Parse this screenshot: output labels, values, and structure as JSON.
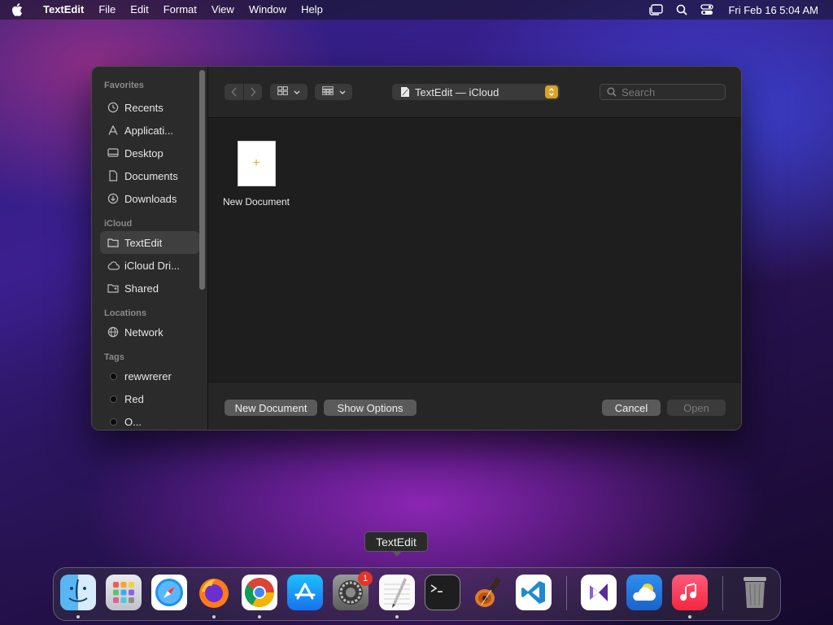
{
  "menubar": {
    "app_name": "TextEdit",
    "menus": [
      "File",
      "Edit",
      "Format",
      "View",
      "Window",
      "Help"
    ],
    "clock": "Fri Feb 16  5:04 AM"
  },
  "dialog": {
    "location": "TextEdit — iCloud",
    "search_placeholder": "Search",
    "sidebar": {
      "favorites_title": "Favorites",
      "favorites": [
        {
          "label": "Recents",
          "icon": "clock-icon"
        },
        {
          "label": "Applicati...",
          "icon": "applications-icon"
        },
        {
          "label": "Desktop",
          "icon": "desktop-icon"
        },
        {
          "label": "Documents",
          "icon": "document-icon"
        },
        {
          "label": "Downloads",
          "icon": "download-icon"
        }
      ],
      "icloud_title": "iCloud",
      "icloud": [
        {
          "label": "TextEdit",
          "icon": "folder-icon",
          "selected": true
        },
        {
          "label": "iCloud Dri...",
          "icon": "cloud-icon"
        },
        {
          "label": "Shared",
          "icon": "shared-folder-icon"
        }
      ],
      "locations_title": "Locations",
      "locations": [
        {
          "label": "Network",
          "icon": "globe-icon"
        }
      ],
      "tags_title": "Tags",
      "tags": [
        {
          "label": "rewwrerer"
        },
        {
          "label": "Red"
        },
        {
          "label": "O..."
        }
      ]
    },
    "files": [
      {
        "label": "New Document",
        "icon": "new-document-icon"
      }
    ],
    "buttons": {
      "new_document": "New Document",
      "show_options": "Show Options",
      "cancel": "Cancel",
      "open": "Open"
    }
  },
  "tooltip": "TextEdit",
  "dock": {
    "items": [
      {
        "name": "Finder",
        "icon": "finder-icon",
        "running": true
      },
      {
        "name": "Launchpad",
        "icon": "launchpad-icon",
        "running": false
      },
      {
        "name": "Safari",
        "icon": "safari-icon",
        "running": false
      },
      {
        "name": "Firefox",
        "icon": "firefox-icon",
        "running": true
      },
      {
        "name": "Chrome",
        "icon": "chrome-icon",
        "running": true
      },
      {
        "name": "App Store",
        "icon": "app-store-icon",
        "running": false
      },
      {
        "name": "System Preferences",
        "icon": "system-preferences-icon",
        "running": false,
        "badge": "1"
      },
      {
        "name": "TextEdit",
        "icon": "textedit-icon",
        "running": true
      },
      {
        "name": "Terminal",
        "icon": "terminal-icon",
        "running": false
      },
      {
        "name": "GarageBand",
        "icon": "garageband-icon",
        "running": false
      },
      {
        "name": "Visual Studio Code",
        "icon": "vscode-icon",
        "running": false
      },
      {
        "name": "Visual Studio",
        "icon": "visual-studio-icon",
        "running": false
      },
      {
        "name": "Weather",
        "icon": "weather-icon",
        "running": false
      },
      {
        "name": "Music",
        "icon": "music-icon",
        "running": true
      },
      {
        "name": "Trash",
        "icon": "trash-icon",
        "running": false
      }
    ],
    "badge": "1"
  },
  "colors": {
    "accent_stepper": "#d9a32a",
    "badge_red": "#e5332a"
  }
}
